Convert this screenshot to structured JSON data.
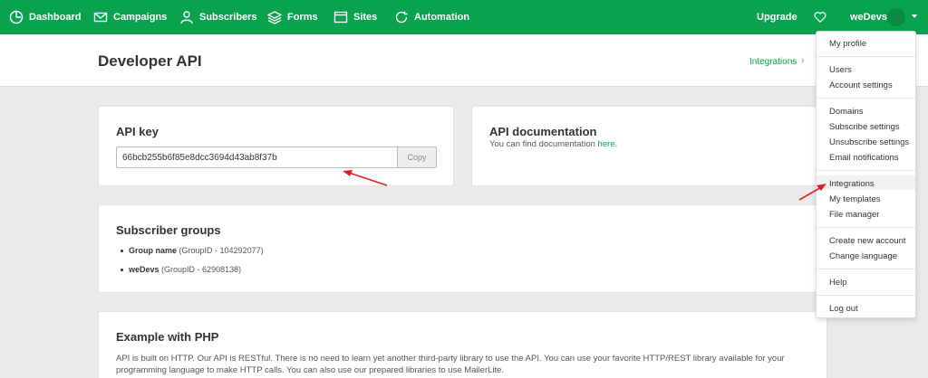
{
  "nav": {
    "items": [
      {
        "label": "Dashboard",
        "icon": "dashboard-icon"
      },
      {
        "label": "Campaigns",
        "icon": "mail-icon"
      },
      {
        "label": "Subscribers",
        "icon": "user-icon"
      },
      {
        "label": "Forms",
        "icon": "layers-icon"
      },
      {
        "label": "Sites",
        "icon": "browser-icon"
      },
      {
        "label": "Automation",
        "icon": "refresh-icon"
      }
    ],
    "upgrade": "Upgrade",
    "account": "weDevs"
  },
  "header": {
    "title": "Developer API",
    "breadcrumb": "Integrations",
    "breadcrumb_chevron": "›"
  },
  "api_key": {
    "title": "API key",
    "value": "66bcb255b6f85e8dcc3694d43ab8f37b",
    "copy_label": "Copy"
  },
  "api_docs": {
    "title": "API documentation",
    "text": "You can find documentation ",
    "link": "here",
    "suffix": "."
  },
  "groups": {
    "title": "Subscriber groups",
    "items": [
      {
        "name": "Group name",
        "id": "(GroupID - 104292077)"
      },
      {
        "name": "weDevs",
        "id": "(GroupID - 62908138)"
      }
    ]
  },
  "php": {
    "title": "Example with PHP",
    "text": "API is built on HTTP. Our API is RESTful. There is no need to learn yet another third-party library to use the API. You can use your favorite HTTP/REST library available for your programming language to make HTTP calls. You can also use our prepared libraries to use MailerLite."
  },
  "dropdown": {
    "items": [
      "My profile",
      "Users",
      "Account settings",
      "Domains",
      "Subscribe settings",
      "Unsubscribe settings",
      "Email notifications",
      "Integrations",
      "My templates",
      "File manager",
      "Create new account",
      "Change language",
      "Help",
      "Log out"
    ],
    "highlighted": "Integrations"
  },
  "colors": {
    "brand": "#09a24e",
    "annotation": "#e02020"
  }
}
